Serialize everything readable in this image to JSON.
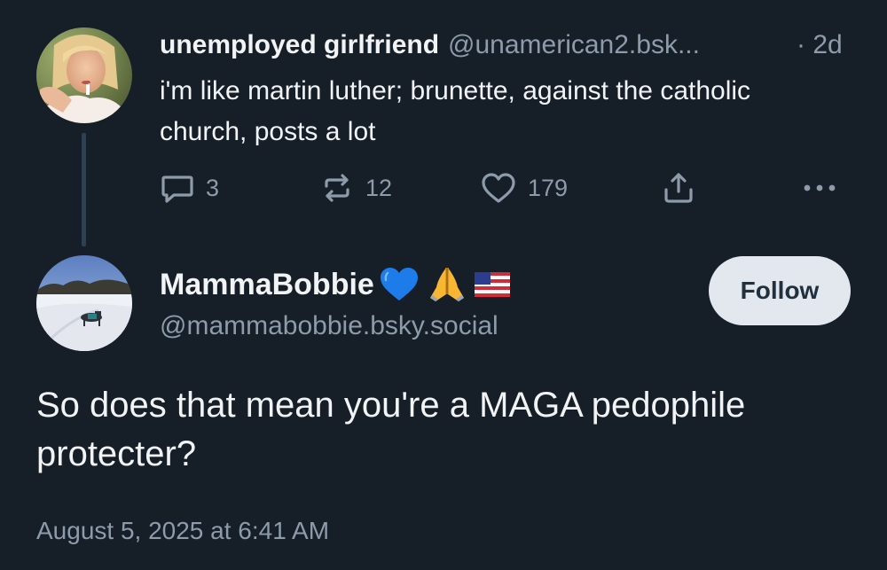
{
  "parent_post": {
    "author_name": "unemployed girlfriend",
    "author_handle": "@unamerican2.bsk...",
    "age": "· 2d",
    "text": "i'm like martin luther; brunette, against the catholic church, posts a lot",
    "actions": {
      "reply_count": "3",
      "repost_count": "12",
      "like_count": "179"
    },
    "icons": [
      "reply-icon",
      "repost-icon",
      "like-icon",
      "share-icon",
      "more-icon"
    ]
  },
  "reply_post": {
    "author_name": "MammaBobbie",
    "name_emojis": [
      "blue-heart-emoji",
      "folded-hands-emoji",
      "us-flag-emoji"
    ],
    "author_handle": "@mammabobbie.bsky.social",
    "follow_label": "Follow",
    "text": "So does that mean you're a MAGA pedophile protecter?",
    "timestamp": "August 5, 2025 at 6:41 AM"
  },
  "colors": {
    "background": "#161e27",
    "primary_text": "#f1f3f5",
    "secondary_text": "#8d9bab",
    "thread_line": "#2e4052",
    "follow_button_bg": "#e3e8ee",
    "follow_button_text": "#20303f"
  }
}
